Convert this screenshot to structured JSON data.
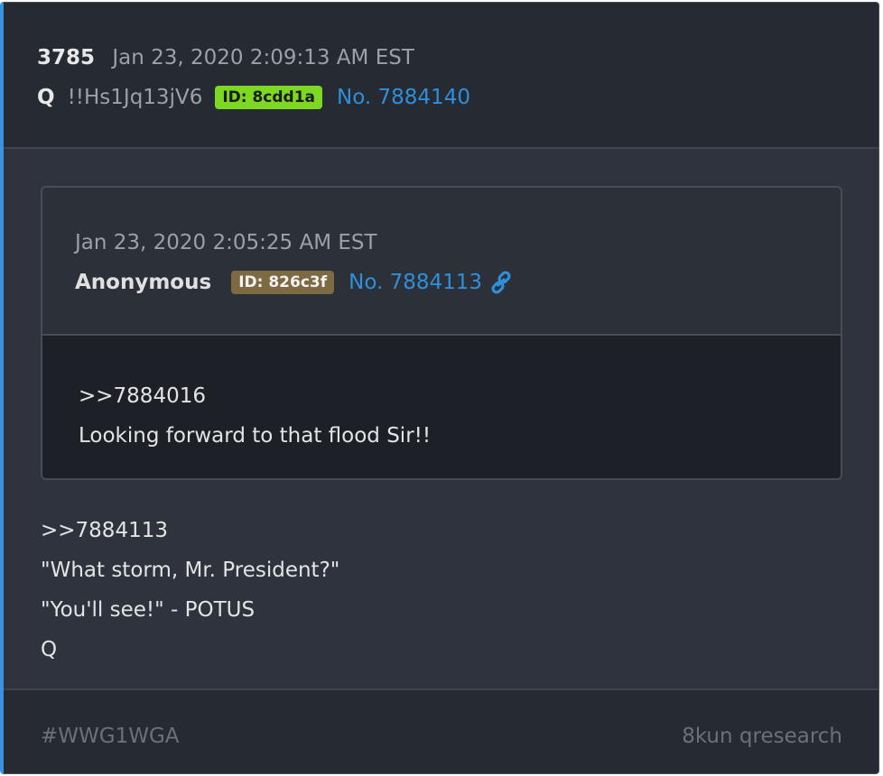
{
  "post": {
    "number": "3785",
    "date": "Jan 23, 2020 2:09:13 AM EST",
    "author": "Q",
    "tripcode": "!!Hs1Jq13jV6",
    "id_badge": "ID: 8cdd1a",
    "post_no": "No. 7884140"
  },
  "quoted": {
    "date": "Jan 23, 2020 2:05:25 AM EST",
    "author": "Anonymous",
    "id_badge": "ID: 826c3f",
    "post_no": "No. 7884113",
    "link_icon": "link-icon",
    "lines": [
      ">>7884016",
      "Looking forward to that flood Sir!!"
    ]
  },
  "message": {
    "lines": [
      ">>7884113",
      "\"What storm, Mr. President?\"",
      "\"You'll see!\" - POTUS",
      "Q"
    ]
  },
  "footer": {
    "hashtag": "#WWG1WGA",
    "source": "8kun qresearch"
  },
  "colors": {
    "accent": "#3a93e0",
    "id_green": "#7cd820",
    "id_brown": "#7d6a42",
    "link": "#2f8fd8"
  }
}
